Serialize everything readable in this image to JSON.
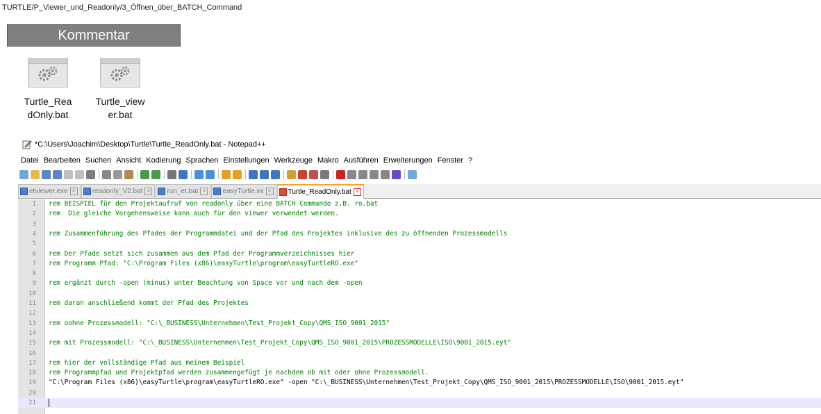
{
  "breadcrumb": "TURTLE/P_Viewer_und_Readonly/3_Öffnen_über_BATCH_Command",
  "kommentar_button": "Kommentar",
  "desktop_icons": [
    {
      "label": "Turtle_Rea\ndOnly.bat",
      "icon": "batch-file-gears-icon"
    },
    {
      "label": "Turtle_view\ner.bat",
      "icon": "batch-file-gears-icon"
    }
  ],
  "window_title": "*C:\\Users\\Joachim\\Desktop\\Turtle\\Turtle_ReadOnly.bat - Notepad++",
  "menu": [
    "Datei",
    "Bearbeiten",
    "Suchen",
    "Ansicht",
    "Kodierung",
    "Sprachen",
    "Einstellungen",
    "Werkzeuge",
    "Makro",
    "Ausführen",
    "Erweiterungen",
    "Fenster",
    "?"
  ],
  "tabs": [
    {
      "label": "etviewer.exe",
      "active": false
    },
    {
      "label": "readonly_V2.bat",
      "active": false
    },
    {
      "label": "run_et.bat",
      "active": false
    },
    {
      "label": "easyTurtle.ini",
      "active": false
    },
    {
      "label": "Turtle_ReadOnly.bat",
      "active": true
    }
  ],
  "lines": [
    {
      "n": "1",
      "text": "rem BEISPIEL für den Projektaufruf von readonly über eine BATCH Commando z.B. ro.bat",
      "kind": "comment"
    },
    {
      "n": "2",
      "text": "rem  Die gleiche Vorgehensweise kann auch für den viewer verwendet werden.",
      "kind": "comment"
    },
    {
      "n": "3",
      "text": "",
      "kind": "comment"
    },
    {
      "n": "4",
      "text": "rem Zusammenführung des Pfades der Programmdatei und der Pfad des Projektes inklusive des zu öffnenden Prozessmodells",
      "kind": "comment"
    },
    {
      "n": "5",
      "text": "",
      "kind": "comment"
    },
    {
      "n": "6",
      "text": "rem Der Pfade setzt sich zusammen aus dem Pfad der Programmverzeichnisses hier",
      "kind": "comment"
    },
    {
      "n": "7",
      "text": "rem Programm Pfad: \"C:\\Program Files (x86)\\easyTurtle\\program\\easyTurtleRO.exe\"",
      "kind": "comment"
    },
    {
      "n": "8",
      "text": "",
      "kind": "comment"
    },
    {
      "n": "9",
      "text": "rem ergänzt durch -open (minus) unter Beachtung von Space vor und nach dem -open",
      "kind": "comment"
    },
    {
      "n": "10",
      "text": "",
      "kind": "comment"
    },
    {
      "n": "11",
      "text": "rem daran anschließend kommt der Pfad des Projektes",
      "kind": "comment"
    },
    {
      "n": "12",
      "text": "",
      "kind": "comment"
    },
    {
      "n": "13",
      "text": "rem oohne Prozessmodell: \"C:\\_BUSINESS\\Unternehmen\\Test_Projekt_Copy\\QMS_ISO_9001_2015\"",
      "kind": "comment"
    },
    {
      "n": "14",
      "text": "",
      "kind": "comment"
    },
    {
      "n": "15",
      "text": "rem mit Prozessmodell: \"C:\\_BUSINESS\\Unternehmen\\Test_Projekt_Copy\\QMS_ISO_9001_2015\\PROZESSMODELLE\\ISO\\9001_2015.eyt\"",
      "kind": "comment"
    },
    {
      "n": "16",
      "text": "",
      "kind": "comment"
    },
    {
      "n": "17",
      "text": "rem hier der vollständige Pfad aus meinem Beispiel",
      "kind": "comment"
    },
    {
      "n": "18",
      "text": "rem Programmpfad und Projektpfad werden zusammengefügt je nachdem ob mit oder ohne Prozessmodell.",
      "kind": "comment"
    },
    {
      "n": "19",
      "text": "\"C:\\Program Files (x86)\\easyTurtle\\program\\easyTurtleRO.exe\" -open \"C:\\_BUSINESS\\Unternehmen\\Test_Projekt_Copy\\QMS_ISO_9001_2015\\PROZESSMODELLE\\ISO\\9001_2015.eyt\"",
      "kind": "plain"
    },
    {
      "n": "20",
      "text": "",
      "kind": "plain"
    },
    {
      "n": "21",
      "text": "",
      "kind": "plain",
      "current": true
    }
  ],
  "toolbar_icons": [
    "new-file-icon",
    "open-file-icon",
    "save-icon",
    "save-all-icon",
    "close-icon",
    "close-all-icon",
    "print-icon",
    "cut-icon",
    "copy-icon",
    "paste-icon",
    "undo-icon",
    "redo-icon",
    "find-icon",
    "replace-icon",
    "zoom-in-icon",
    "zoom-out-icon",
    "sync-v-icon",
    "sync-h-icon",
    "wrap-icon",
    "all-chars-icon",
    "indent-guide-icon",
    "udl-icon",
    "doc-map-icon",
    "function-list-icon",
    "folder-workspace-icon",
    "monitor-icon",
    "record-icon",
    "stop-icon",
    "play-icon",
    "play-multi-icon",
    "save-macro-icon",
    "spellcheck-icon"
  ],
  "colors": {
    "comment": "#008000",
    "tab_active_border": "#f5a623",
    "gutter": "#e4e4e4",
    "current_line": "#e8e8ff"
  }
}
